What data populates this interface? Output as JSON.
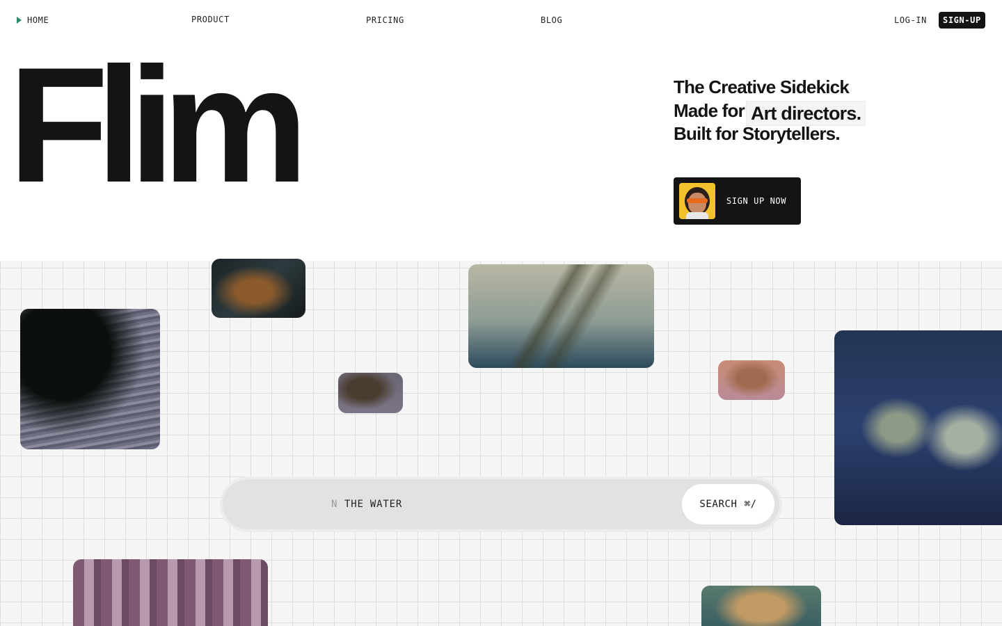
{
  "nav": {
    "home": "HOME",
    "product": "PRODUCT",
    "pricing": "PRICING",
    "blog": "BLOG",
    "login": "LOG-IN",
    "signup": "SIGN-UP"
  },
  "hero": {
    "logo": "Flim",
    "tagline_line1": "The Creative Sidekick",
    "tagline_line2_prefix": "Made for",
    "tagline_line2_highlight": "Art directors.",
    "tagline_line3": "Built for Storytellers.",
    "cta_label": "SIGN UP NOW"
  },
  "search": {
    "prefix": "N",
    "query": "THE WATER",
    "button_label": "SEARCH",
    "shortcut": "⌘/"
  },
  "colors": {
    "accent_nav_triangle": "#2f8a6b",
    "dark": "#141414",
    "grid_bg": "#f5f5f5"
  }
}
